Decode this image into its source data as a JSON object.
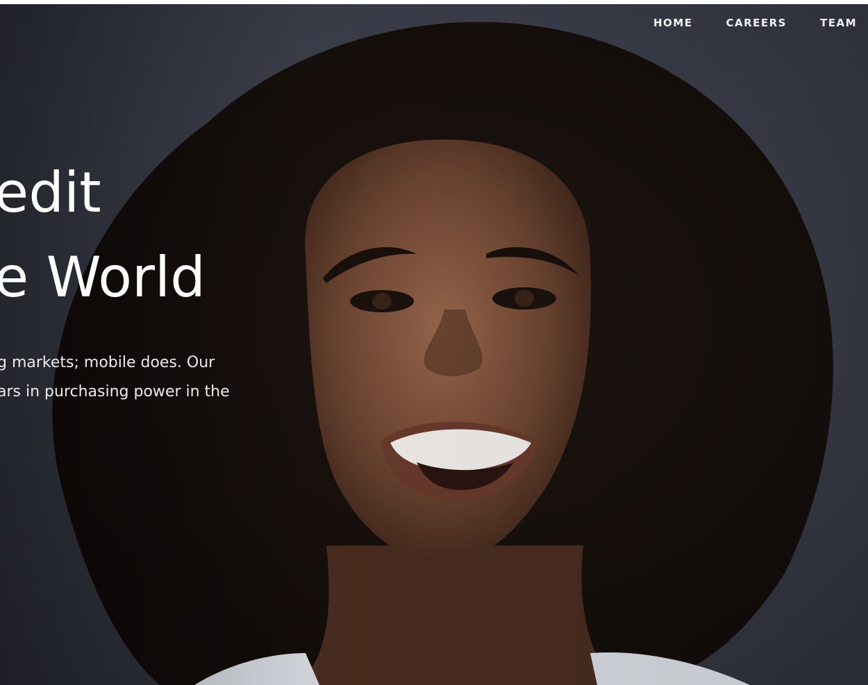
{
  "nav": {
    "items": [
      {
        "label": "HOME"
      },
      {
        "label": "CAREERS"
      },
      {
        "label": "TEAM"
      }
    ]
  },
  "hero": {
    "headline_line1": "edit",
    "headline_line2": "e World",
    "body_line1": "g markets; mobile does. Our",
    "body_line2": "ars in purchasing power in the"
  },
  "colors": {
    "background": "#3e4250",
    "text": "#ffffff"
  }
}
